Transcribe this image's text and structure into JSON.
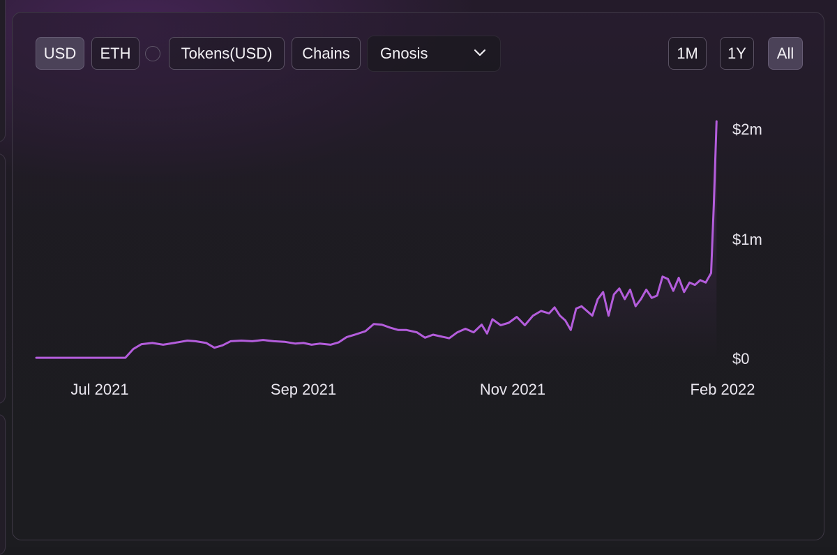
{
  "toolbar": {
    "usd": "USD",
    "eth": "ETH",
    "tokens": "Tokens(USD)",
    "chains": "Chains",
    "chain_select": "Gnosis",
    "range_1m": "1M",
    "range_1y": "1Y",
    "range_all": "All",
    "active_currency": "USD",
    "active_range": "All"
  },
  "colors": {
    "line": "#b45ddc",
    "background": "#1b1b1f",
    "active_button": "#4b4258"
  },
  "icons": {
    "select_toggle": "chevron-down-icon",
    "toggle": "radio-circle-icon"
  },
  "chart_data": {
    "type": "area",
    "title": "",
    "xlabel": "",
    "ylabel": "",
    "x_ticks": [
      "Jul 2021",
      "Sep 2021",
      "Nov 2021",
      "Feb 2022"
    ],
    "y_ticks": [
      "$0",
      "$1m",
      "$2m"
    ],
    "ylim": [
      0,
      2000000
    ],
    "xlim": [
      "2021-06-01",
      "2022-02-10"
    ],
    "grid": false,
    "legend": "none",
    "series": [
      {
        "values": [
          [
            "2021-06-01",
            5000
          ],
          [
            "2021-06-10",
            5000
          ],
          [
            "2021-06-20",
            5000
          ],
          [
            "2021-06-30",
            5000
          ],
          [
            "2021-07-04",
            5000
          ],
          [
            "2021-07-07",
            80000
          ],
          [
            "2021-07-10",
            120000
          ],
          [
            "2021-07-14",
            130000
          ],
          [
            "2021-07-18",
            115000
          ],
          [
            "2021-07-22",
            130000
          ],
          [
            "2021-07-27",
            150000
          ],
          [
            "2021-07-30",
            145000
          ],
          [
            "2021-08-03",
            130000
          ],
          [
            "2021-08-06",
            90000
          ],
          [
            "2021-08-09",
            110000
          ],
          [
            "2021-08-12",
            145000
          ],
          [
            "2021-08-16",
            150000
          ],
          [
            "2021-08-20",
            145000
          ],
          [
            "2021-08-24",
            155000
          ],
          [
            "2021-08-28",
            145000
          ],
          [
            "2021-09-01",
            140000
          ],
          [
            "2021-09-05",
            125000
          ],
          [
            "2021-09-08",
            130000
          ],
          [
            "2021-09-11",
            115000
          ],
          [
            "2021-09-14",
            125000
          ],
          [
            "2021-09-18",
            115000
          ],
          [
            "2021-09-21",
            135000
          ],
          [
            "2021-09-24",
            180000
          ],
          [
            "2021-09-27",
            200000
          ],
          [
            "2021-10-01",
            230000
          ],
          [
            "2021-10-04",
            290000
          ],
          [
            "2021-10-07",
            285000
          ],
          [
            "2021-10-10",
            260000
          ],
          [
            "2021-10-13",
            240000
          ],
          [
            "2021-10-16",
            240000
          ],
          [
            "2021-10-20",
            220000
          ],
          [
            "2021-10-23",
            175000
          ],
          [
            "2021-10-26",
            200000
          ],
          [
            "2021-10-29",
            185000
          ],
          [
            "2021-11-01",
            170000
          ],
          [
            "2021-11-04",
            220000
          ],
          [
            "2021-11-07",
            250000
          ],
          [
            "2021-11-10",
            220000
          ],
          [
            "2021-11-13",
            285000
          ],
          [
            "2021-11-15",
            210000
          ],
          [
            "2021-11-17",
            330000
          ],
          [
            "2021-11-20",
            280000
          ],
          [
            "2021-11-23",
            300000
          ],
          [
            "2021-11-26",
            350000
          ],
          [
            "2021-11-29",
            280000
          ],
          [
            "2021-12-02",
            360000
          ],
          [
            "2021-12-05",
            400000
          ],
          [
            "2021-12-08",
            380000
          ],
          [
            "2021-12-10",
            430000
          ],
          [
            "2021-12-12",
            360000
          ],
          [
            "2021-12-14",
            320000
          ],
          [
            "2021-12-16",
            240000
          ],
          [
            "2021-12-18",
            420000
          ],
          [
            "2021-12-20",
            440000
          ],
          [
            "2021-12-22",
            400000
          ],
          [
            "2021-12-24",
            360000
          ],
          [
            "2021-12-26",
            500000
          ],
          [
            "2021-12-28",
            560000
          ],
          [
            "2021-12-30",
            360000
          ],
          [
            "2022-01-01",
            540000
          ],
          [
            "2022-01-03",
            590000
          ],
          [
            "2022-01-05",
            500000
          ],
          [
            "2022-01-07",
            580000
          ],
          [
            "2022-01-09",
            440000
          ],
          [
            "2022-01-11",
            500000
          ],
          [
            "2022-01-13",
            580000
          ],
          [
            "2022-01-15",
            510000
          ],
          [
            "2022-01-17",
            530000
          ],
          [
            "2022-01-19",
            690000
          ],
          [
            "2022-01-21",
            670000
          ],
          [
            "2022-01-23",
            570000
          ],
          [
            "2022-01-25",
            680000
          ],
          [
            "2022-01-27",
            560000
          ],
          [
            "2022-01-29",
            640000
          ],
          [
            "2022-01-31",
            620000
          ],
          [
            "2022-02-02",
            660000
          ],
          [
            "2022-02-04",
            640000
          ],
          [
            "2022-02-06",
            720000
          ],
          [
            "2022-02-07",
            1300000
          ],
          [
            "2022-02-08",
            2000000
          ]
        ]
      }
    ]
  }
}
